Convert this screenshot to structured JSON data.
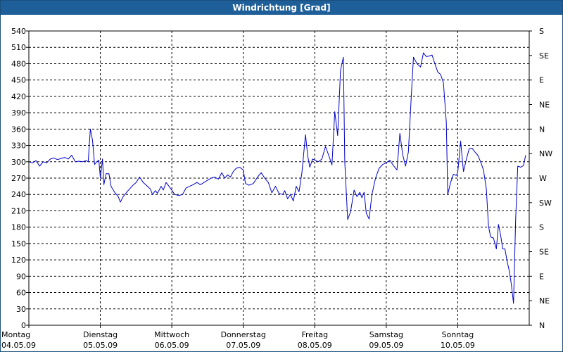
{
  "window": {
    "title": "Windrichtung [Grad]"
  },
  "chart_data": {
    "type": "line",
    "title": "Windrichtung [Grad]",
    "xlabel": "",
    "ylabel": "",
    "ylim": [
      0,
      540
    ],
    "grid": true,
    "y_ticks_left": [
      0,
      30,
      60,
      90,
      120,
      150,
      180,
      210,
      240,
      270,
      300,
      330,
      360,
      390,
      420,
      450,
      480,
      510,
      540
    ],
    "y_ticks_right": [
      {
        "value": 0,
        "label": "N"
      },
      {
        "value": 45,
        "label": "NE"
      },
      {
        "value": 90,
        "label": "E"
      },
      {
        "value": 135,
        "label": "SE"
      },
      {
        "value": 180,
        "label": "S"
      },
      {
        "value": 225,
        "label": "SW"
      },
      {
        "value": 270,
        "label": "W"
      },
      {
        "value": 315,
        "label": "NW"
      },
      {
        "value": 360,
        "label": "N"
      },
      {
        "value": 405,
        "label": "NE"
      },
      {
        "value": 450,
        "label": "E"
      },
      {
        "value": 495,
        "label": "SE"
      },
      {
        "value": 540,
        "label": "S"
      }
    ],
    "x_ticks": [
      {
        "day": 0,
        "weekday": "Montag",
        "date": "04.05.09"
      },
      {
        "day": 1,
        "weekday": "Dienstag",
        "date": "05.05.09"
      },
      {
        "day": 2,
        "weekday": "Mittwoch",
        "date": "06.05.09"
      },
      {
        "day": 3,
        "weekday": "Donnerstag",
        "date": "07.05.09"
      },
      {
        "day": 4,
        "weekday": "Freitag",
        "date": "08.05.09"
      },
      {
        "day": 5,
        "weekday": "Samstag",
        "date": "09.05.09"
      },
      {
        "day": 6,
        "weekday": "Sonntag",
        "date": "10.05.09"
      }
    ],
    "xlim_days": [
      0,
      7
    ],
    "series": [
      {
        "color": "#0000cc",
        "points": [
          [
            0.0,
            300
          ],
          [
            0.05,
            298
          ],
          [
            0.1,
            302
          ],
          [
            0.15,
            292
          ],
          [
            0.2,
            300
          ],
          [
            0.25,
            298
          ],
          [
            0.3,
            305
          ],
          [
            0.35,
            307
          ],
          [
            0.4,
            304
          ],
          [
            0.45,
            306
          ],
          [
            0.5,
            308
          ],
          [
            0.55,
            305
          ],
          [
            0.6,
            312
          ],
          [
            0.65,
            300
          ],
          [
            0.7,
            301
          ],
          [
            0.75,
            300
          ],
          [
            0.8,
            302
          ],
          [
            0.83,
            300
          ],
          [
            0.86,
            360
          ],
          [
            0.89,
            340
          ],
          [
            0.92,
            295
          ],
          [
            0.95,
            300
          ],
          [
            0.98,
            303
          ],
          [
            1.0,
            270
          ],
          [
            1.03,
            305
          ],
          [
            1.05,
            258
          ],
          [
            1.08,
            278
          ],
          [
            1.12,
            278
          ],
          [
            1.15,
            255
          ],
          [
            1.2,
            244
          ],
          [
            1.25,
            236
          ],
          [
            1.28,
            226
          ],
          [
            1.32,
            236
          ],
          [
            1.38,
            246
          ],
          [
            1.45,
            256
          ],
          [
            1.5,
            262
          ],
          [
            1.55,
            272
          ],
          [
            1.6,
            262
          ],
          [
            1.65,
            256
          ],
          [
            1.7,
            250
          ],
          [
            1.73,
            240
          ],
          [
            1.77,
            247
          ],
          [
            1.8,
            242
          ],
          [
            1.85,
            255
          ],
          [
            1.88,
            248
          ],
          [
            1.92,
            262
          ],
          [
            1.96,
            255
          ],
          [
            2.0,
            248
          ],
          [
            2.04,
            240
          ],
          [
            2.1,
            238
          ],
          [
            2.15,
            240
          ],
          [
            2.2,
            252
          ],
          [
            2.25,
            255
          ],
          [
            2.3,
            258
          ],
          [
            2.35,
            262
          ],
          [
            2.4,
            258
          ],
          [
            2.45,
            262
          ],
          [
            2.5,
            266
          ],
          [
            2.55,
            270
          ],
          [
            2.6,
            272
          ],
          [
            2.65,
            268
          ],
          [
            2.7,
            280
          ],
          [
            2.74,
            270
          ],
          [
            2.78,
            276
          ],
          [
            2.82,
            272
          ],
          [
            2.86,
            282
          ],
          [
            2.9,
            288
          ],
          [
            2.95,
            290
          ],
          [
            3.0,
            285
          ],
          [
            3.03,
            260
          ],
          [
            3.08,
            257
          ],
          [
            3.14,
            260
          ],
          [
            3.2,
            272
          ],
          [
            3.25,
            280
          ],
          [
            3.3,
            270
          ],
          [
            3.35,
            262
          ],
          [
            3.4,
            243
          ],
          [
            3.45,
            255
          ],
          [
            3.5,
            242
          ],
          [
            3.55,
            240
          ],
          [
            3.58,
            247
          ],
          [
            3.62,
            232
          ],
          [
            3.66,
            240
          ],
          [
            3.7,
            228
          ],
          [
            3.74,
            255
          ],
          [
            3.78,
            245
          ],
          [
            3.82,
            280
          ],
          [
            3.87,
            350
          ],
          [
            3.9,
            312
          ],
          [
            3.93,
            290
          ],
          [
            3.97,
            305
          ],
          [
            4.05,
            300
          ],
          [
            4.1,
            305
          ],
          [
            4.15,
            328
          ],
          [
            4.2,
            310
          ],
          [
            4.24,
            294
          ],
          [
            4.28,
            392
          ],
          [
            4.32,
            348
          ],
          [
            4.36,
            468
          ],
          [
            4.4,
            492
          ],
          [
            4.42,
            300
          ],
          [
            4.46,
            194
          ],
          [
            4.5,
            208
          ],
          [
            4.55,
            248
          ],
          [
            4.59,
            236
          ],
          [
            4.63,
            244
          ],
          [
            4.66,
            234
          ],
          [
            4.69,
            244
          ],
          [
            4.72,
            206
          ],
          [
            4.76,
            195
          ],
          [
            4.8,
            240
          ],
          [
            4.85,
            270
          ],
          [
            4.9,
            288
          ],
          [
            4.95,
            295
          ],
          [
            5.0,
            298
          ],
          [
            5.05,
            303
          ],
          [
            5.1,
            293
          ],
          [
            5.15,
            285
          ],
          [
            5.19,
            352
          ],
          [
            5.23,
            313
          ],
          [
            5.27,
            292
          ],
          [
            5.31,
            318
          ],
          [
            5.35,
            420
          ],
          [
            5.38,
            492
          ],
          [
            5.43,
            480
          ],
          [
            5.48,
            474
          ],
          [
            5.52,
            500
          ],
          [
            5.56,
            493
          ],
          [
            5.6,
            494
          ],
          [
            5.64,
            496
          ],
          [
            5.68,
            480
          ],
          [
            5.72,
            465
          ],
          [
            5.76,
            460
          ],
          [
            5.8,
            445
          ],
          [
            5.84,
            372
          ],
          [
            5.86,
            240
          ],
          [
            5.9,
            262
          ],
          [
            5.94,
            277
          ],
          [
            5.98,
            275
          ],
          [
            6.0,
            280
          ],
          [
            6.04,
            338
          ],
          [
            6.08,
            282
          ],
          [
            6.12,
            304
          ],
          [
            6.16,
            324
          ],
          [
            6.2,
            325
          ],
          [
            6.24,
            318
          ],
          [
            6.28,
            312
          ],
          [
            6.32,
            300
          ],
          [
            6.36,
            285
          ],
          [
            6.4,
            250
          ],
          [
            6.43,
            182
          ],
          [
            6.46,
            162
          ],
          [
            6.5,
            160
          ],
          [
            6.54,
            140
          ],
          [
            6.57,
            185
          ],
          [
            6.6,
            165
          ],
          [
            6.63,
            140
          ],
          [
            6.66,
            140
          ],
          [
            6.69,
            118
          ],
          [
            6.72,
            100
          ],
          [
            6.75,
            75
          ],
          [
            6.78,
            40
          ],
          [
            6.81,
            193
          ],
          [
            6.84,
            292
          ],
          [
            6.88,
            290
          ],
          [
            6.92,
            293
          ],
          [
            6.95,
            312
          ]
        ]
      }
    ]
  }
}
